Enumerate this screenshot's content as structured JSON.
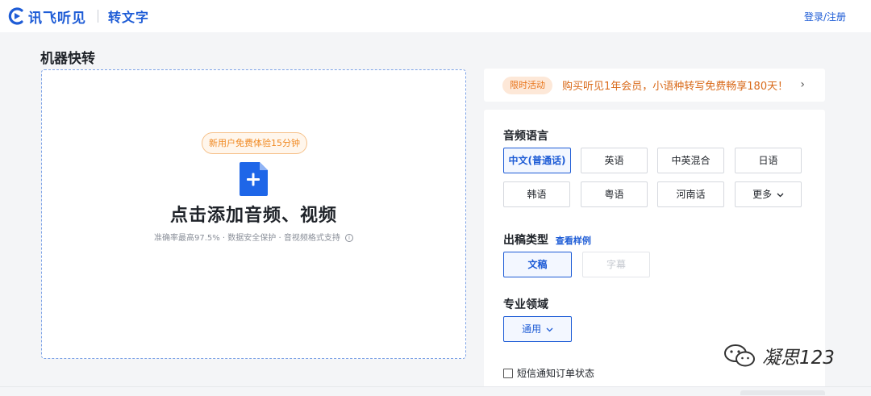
{
  "header": {
    "logo_text": "讯飞听见",
    "product_name": "转文字",
    "login_label": "登录/注册",
    "brand_color": "#1e5cd6"
  },
  "page": {
    "title": "机器快转"
  },
  "upload": {
    "badge": "新用户免费体验15分钟",
    "main_text": "点击添加音频、视频",
    "sub_text": "准确率最高97.5% · 数据安全保护 · 音视频格式支持",
    "info_glyph": "i",
    "icon": "file-add-icon"
  },
  "promo": {
    "tag": "限时活动",
    "text": "购买听见1年会员，小语种转写免费畅享180天！",
    "chevron": "›"
  },
  "settings": {
    "audio_language": {
      "label": "音频语言",
      "options": [
        "中文(普通话)",
        "英语",
        "中英混合",
        "日语",
        "韩语",
        "粤语",
        "河南话",
        "更多"
      ],
      "selected": "中文(普通话)"
    },
    "output_type": {
      "label": "出稿类型",
      "sample_link": "查看样例",
      "options": [
        "文稿",
        "字幕"
      ],
      "selected": "文稿"
    },
    "domain": {
      "label": "专业领域",
      "selected": "通用"
    },
    "sms_notify": {
      "label": "短信通知订单状态",
      "checked": false
    }
  },
  "watermark": {
    "text": "凝思123"
  }
}
